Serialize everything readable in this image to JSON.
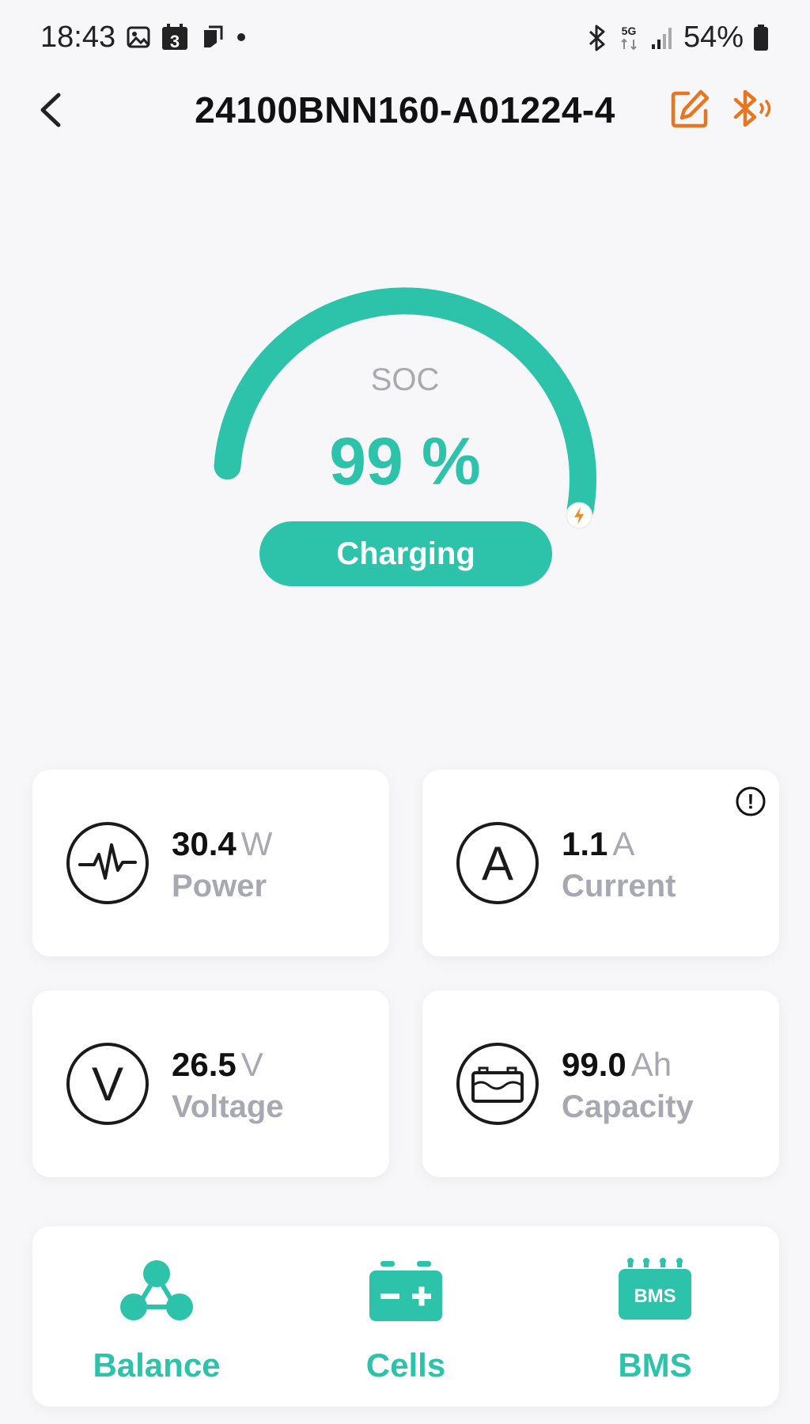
{
  "status_bar": {
    "time": "18:43",
    "calendar_day": "3",
    "network": "5G",
    "battery": "54%"
  },
  "header": {
    "title": "24100BNN160-A01224-4"
  },
  "gauge": {
    "label": "SOC",
    "value": "99 %",
    "level_fraction": 0.99,
    "status": "Charging",
    "accent_color": "#2cc3aa",
    "bolt_color": "#f08a24"
  },
  "cards": {
    "power": {
      "value": "30.4",
      "unit": "W",
      "label": "Power"
    },
    "current": {
      "value": "1.1",
      "unit": "A",
      "label": "Current"
    },
    "voltage": {
      "value": "26.5",
      "unit": "V",
      "label": "Voltage"
    },
    "capacity": {
      "value": "99.0",
      "unit": "Ah",
      "label": "Capacity"
    }
  },
  "icons": {
    "current_letter": "A",
    "voltage_letter": "V",
    "bms_badge": "BMS",
    "info_glyph": "!"
  },
  "nav": {
    "balance": "Balance",
    "cells": "Cells",
    "bms": "BMS"
  },
  "colors": {
    "accent": "#2cc3aa",
    "orange": "#e8751f",
    "muted_text": "#a8a8b2"
  }
}
